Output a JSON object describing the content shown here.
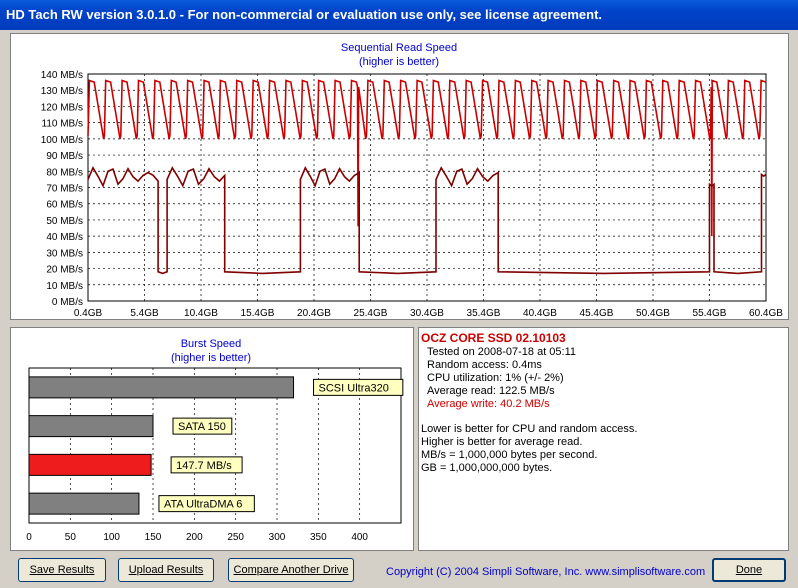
{
  "window": {
    "title": "HD Tach RW version 3.0.1.0  - For non-commercial or evaluation use only, see license agreement."
  },
  "seq_chart": {
    "title": "Sequential Read Speed",
    "subtitle": "(higher is better)"
  },
  "burst_chart": {
    "title": "Burst Speed",
    "subtitle": "(higher is better)"
  },
  "chart_data": [
    {
      "type": "line",
      "title": "Sequential Read Speed",
      "subtitle": "(higher is better)",
      "ylim": [
        0,
        140
      ],
      "xlim": [
        0.4,
        60.4
      ],
      "y_ticks": [
        0,
        10,
        20,
        30,
        40,
        50,
        60,
        70,
        80,
        90,
        100,
        110,
        120,
        130,
        140
      ],
      "y_unit": "MB/s",
      "x_ticks": [
        "0.4GB",
        "5.4GB",
        "10.4GB",
        "15.4GB",
        "20.4GB",
        "25.4GB",
        "30.4GB",
        "35.4GB",
        "40.4GB",
        "45.4GB",
        "50.4GB",
        "55.4GB",
        "60.4GB"
      ],
      "grid": true,
      "series": [
        {
          "color": "#cc0000",
          "pattern": "sawtooth",
          "low": 100,
          "high": 136,
          "cycle_gb": 1.45,
          "dips": [
            {
              "x": 24.3,
              "y": 46
            },
            {
              "x": 55.6,
              "y": 40
            }
          ]
        },
        {
          "color": "#800000",
          "segments": [
            {
              "x0": 0.4,
              "x1": 6.6,
              "y": 78,
              "jitter": 6
            },
            {
              "x0": 6.6,
              "x1": 7.4,
              "y": 18
            },
            {
              "x0": 7.4,
              "x1": 12.5,
              "y": 78,
              "jitter": 6
            },
            {
              "x0": 12.5,
              "x1": 19.2,
              "y": 18
            },
            {
              "x0": 19.2,
              "x1": 24.4,
              "y": 78,
              "jitter": 6
            },
            {
              "x0": 24.4,
              "x1": 31.2,
              "y": 18
            },
            {
              "x0": 31.2,
              "x1": 36.7,
              "y": 78,
              "jitter": 6
            },
            {
              "x0": 36.7,
              "x1": 55.4,
              "y": 18
            },
            {
              "x0": 55.4,
              "x1": 55.8,
              "y": 72
            },
            {
              "x0": 55.8,
              "x1": 60.0,
              "y": 18
            },
            {
              "x0": 60.0,
              "x1": 60.4,
              "y": 78
            }
          ]
        }
      ]
    },
    {
      "type": "bar",
      "title": "Burst Speed",
      "subtitle": "(higher is better)",
      "orientation": "horizontal",
      "xlim": [
        0,
        450
      ],
      "x_ticks": [
        0,
        50,
        100,
        150,
        200,
        250,
        300,
        350,
        400
      ],
      "categories": [
        "SCSI Ultra320",
        "SATA 150",
        "147.7 MB/s",
        "ATA UltraDMA 6"
      ],
      "values": [
        320,
        150,
        147.7,
        133
      ],
      "colors": [
        "#808080",
        "#808080",
        "#ee1c1c",
        "#808080"
      ]
    }
  ],
  "info": {
    "drive_name": "OCZ CORE SSD 02.10103",
    "tested_on": "Tested on 2008-07-18 at 05:11",
    "random_access": "Random access: 0.4ms",
    "cpu": "CPU utilization: 1% (+/- 2%)",
    "avg_read": "Average read: 122.5 MB/s",
    "avg_write": "Average write: 40.2 MB/s",
    "note1": "Lower is better for CPU and random access.",
    "note2": "Higher is better for average read.",
    "note3": "MB/s = 1,000,000 bytes per second.",
    "note4": "GB = 1,000,000,000 bytes."
  },
  "buttons": {
    "save": "Save Results",
    "upload": "Upload Results",
    "compare": "Compare Another Drive",
    "done": "Done"
  },
  "copyright": "Copyright (C) 2004 Simpli Software, Inc. www.simplisoftware.com",
  "colors": {
    "accent_red": "#cc0000",
    "dark_red": "#800000",
    "title_blue": "#0042c8",
    "link_blue": "#0000cc"
  }
}
